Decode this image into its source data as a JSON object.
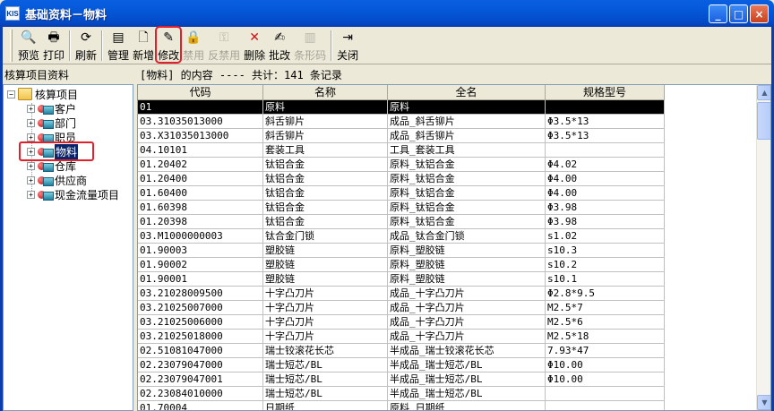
{
  "window": {
    "icon_text": "KIS",
    "title": "基础资料－物料",
    "min": "_",
    "max": "□",
    "close": "×"
  },
  "toolbar": [
    {
      "label": "预览",
      "icon": "preview-icon",
      "glyph": "🔍",
      "disabled": false
    },
    {
      "label": "打印",
      "icon": "printer-icon",
      "glyph": "🖶",
      "disabled": false
    },
    {
      "sep": true
    },
    {
      "label": "刷新",
      "icon": "refresh-icon",
      "glyph": "⟳",
      "disabled": false
    },
    {
      "sep": true
    },
    {
      "label": "管理",
      "icon": "manage-icon",
      "glyph": "▤",
      "disabled": false
    },
    {
      "label": "新增",
      "icon": "new-document-icon",
      "glyph": "🗋",
      "disabled": false
    },
    {
      "label": "修改",
      "icon": "edit-icon",
      "glyph": "✎",
      "disabled": false,
      "highlight": true
    },
    {
      "label": "禁用",
      "icon": "lock-icon",
      "glyph": "🔒",
      "disabled": true
    },
    {
      "label": "反禁用",
      "icon": "key-icon",
      "glyph": "⚿",
      "disabled": true
    },
    {
      "label": "删除",
      "icon": "delete-icon",
      "glyph": "✕",
      "disabled": false,
      "color": "#d01010"
    },
    {
      "label": "批改",
      "icon": "batch-edit-icon",
      "glyph": "✍",
      "disabled": false
    },
    {
      "label": "条形码",
      "icon": "barcode-icon",
      "glyph": "▥",
      "disabled": true
    },
    {
      "sep": true
    },
    {
      "label": "关闭",
      "icon": "exit-door-icon",
      "glyph": "⇥",
      "disabled": false
    }
  ],
  "left_panel": {
    "header": "核算项目资料",
    "tree": {
      "root": "核算项目",
      "children": [
        {
          "label": "客户",
          "icon": "customer-icon"
        },
        {
          "label": "部门",
          "icon": "department-icon"
        },
        {
          "label": "职员",
          "icon": "employee-icon"
        },
        {
          "label": "物料",
          "icon": "material-icon",
          "selected": true
        },
        {
          "label": "仓库",
          "icon": "warehouse-icon"
        },
        {
          "label": "供应商",
          "icon": "supplier-icon"
        },
        {
          "label": "现金流量项目",
          "icon": "cashflow-icon"
        }
      ]
    }
  },
  "grid": {
    "header_text": "[物料] 的内容 ---- 共计：141 条记录",
    "columns": [
      "代码",
      "名称",
      "全名",
      "规格型号"
    ],
    "rows": [
      [
        "01",
        "原料",
        "原料",
        ""
      ],
      [
        "03.31035013000",
        "斜舌铆片",
        "成品_斜舌铆片",
        "Φ3.5*13"
      ],
      [
        "03.X31035013000",
        "斜舌铆片",
        "成品_斜舌铆片",
        "Φ3.5*13"
      ],
      [
        "04.10101",
        "套装工具",
        "工具_套装工具",
        ""
      ],
      [
        "01.20402",
        "钛铝合金",
        "原料_钛铝合金",
        "Φ4.02"
      ],
      [
        "01.20400",
        "钛铝合金",
        "原料_钛铝合金",
        "Φ4.00"
      ],
      [
        "01.60400",
        "钛铝合金",
        "原料_钛铝合金",
        "Φ4.00"
      ],
      [
        "01.60398",
        "钛铝合金",
        "原料_钛铝合金",
        "Φ3.98"
      ],
      [
        "01.20398",
        "钛铝合金",
        "原料_钛铝合金",
        "Φ3.98"
      ],
      [
        "03.M1000000003",
        "钛合金门锁",
        "成品_钛合金门锁",
        "s1.02"
      ],
      [
        "01.90003",
        "塑胶链",
        "原料_塑胶链",
        "s10.3"
      ],
      [
        "01.90002",
        "塑胶链",
        "原料_塑胶链",
        "s10.2"
      ],
      [
        "01.90001",
        "塑胶链",
        "原料_塑胶链",
        "s10.1"
      ],
      [
        "03.21028009500",
        "十字凸刀片",
        "成品_十字凸刀片",
        "Φ2.8*9.5"
      ],
      [
        "03.21025007000",
        "十字凸刀片",
        "成品_十字凸刀片",
        "M2.5*7"
      ],
      [
        "03.21025006000",
        "十字凸刀片",
        "成品_十字凸刀片",
        "M2.5*6"
      ],
      [
        "03.21025018000",
        "十字凸刀片",
        "成品_十字凸刀片",
        "M2.5*18"
      ],
      [
        "02.51081047000",
        "瑞士铰滚花长芯",
        "半成品_瑞士铰滚花长芯",
        "7.93*47"
      ],
      [
        "02.23079047000",
        "瑞士短芯/BL",
        "半成品_瑞士短芯/BL",
        "Φ10.00"
      ],
      [
        "02.23079047001",
        "瑞士短芯/BL",
        "半成品_瑞士短芯/BL",
        "Φ10.00"
      ],
      [
        "02.23084010000",
        "瑞士短芯/BL",
        "半成品_瑞士短芯/BL",
        ""
      ],
      [
        "01.70004",
        "日期纸",
        "原料_日期纸",
        ""
      ]
    ]
  }
}
